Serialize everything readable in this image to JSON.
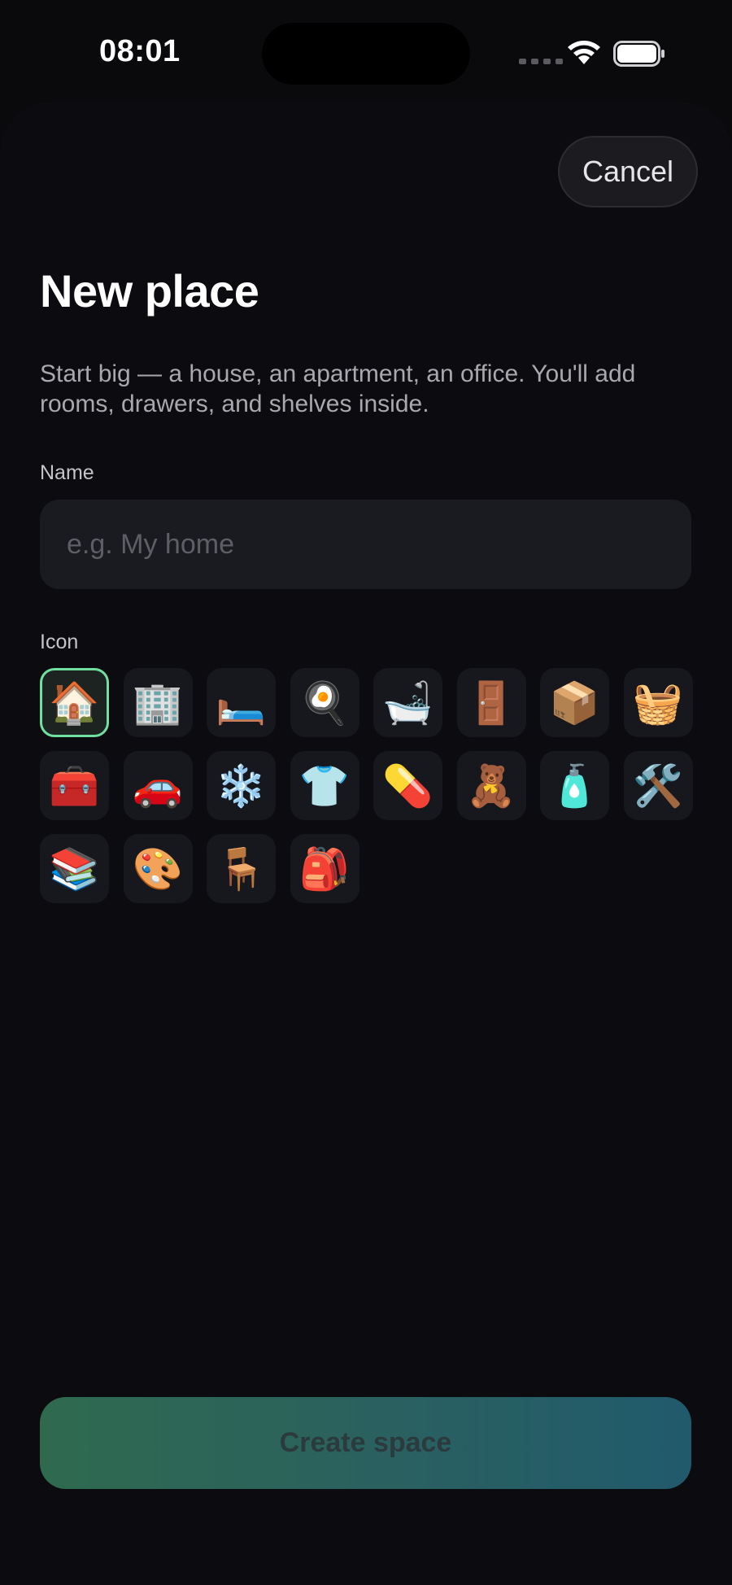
{
  "status_bar": {
    "time": "08:01"
  },
  "sheet": {
    "cancel_label": "Cancel",
    "title": "New place",
    "description": "Start big — a house, an apartment, an office. You'll add rooms, drawers, and shelves inside.",
    "name_label": "Name",
    "name_placeholder": "e.g. My home",
    "name_value": "",
    "icon_label": "Icon",
    "icons": [
      {
        "name": "house-icon",
        "glyph": "🏠",
        "selected": true
      },
      {
        "name": "office-building-icon",
        "glyph": "🏢",
        "selected": false
      },
      {
        "name": "bed-icon",
        "glyph": "🛏️",
        "selected": false
      },
      {
        "name": "frying-pan-icon",
        "glyph": "🍳",
        "selected": false
      },
      {
        "name": "bathtub-icon",
        "glyph": "🛁",
        "selected": false
      },
      {
        "name": "door-icon",
        "glyph": "🚪",
        "selected": false
      },
      {
        "name": "package-icon",
        "glyph": "📦",
        "selected": false
      },
      {
        "name": "basket-icon",
        "glyph": "🧺",
        "selected": false
      },
      {
        "name": "toolbox-icon",
        "glyph": "🧰",
        "selected": false
      },
      {
        "name": "car-icon",
        "glyph": "🚗",
        "selected": false
      },
      {
        "name": "snowflake-icon",
        "glyph": "❄️",
        "selected": false
      },
      {
        "name": "shirt-icon",
        "glyph": "👕",
        "selected": false
      },
      {
        "name": "pill-icon",
        "glyph": "💊",
        "selected": false
      },
      {
        "name": "teddy-bear-icon",
        "glyph": "🧸",
        "selected": false
      },
      {
        "name": "lotion-bottle-icon",
        "glyph": "🧴",
        "selected": false
      },
      {
        "name": "hammer-wrench-icon",
        "glyph": "🛠️",
        "selected": false
      },
      {
        "name": "books-icon",
        "glyph": "📚",
        "selected": false
      },
      {
        "name": "palette-icon",
        "glyph": "🎨",
        "selected": false
      },
      {
        "name": "chair-icon",
        "glyph": "🪑",
        "selected": false
      },
      {
        "name": "backpack-icon",
        "glyph": "🎒",
        "selected": false
      }
    ],
    "create_label": "Create space"
  },
  "colors": {
    "background": "#0a0a0d",
    "selected_border": "#6fe0a0",
    "create_gradient_start": "#2f6a4f",
    "create_gradient_end": "#215a6c"
  }
}
